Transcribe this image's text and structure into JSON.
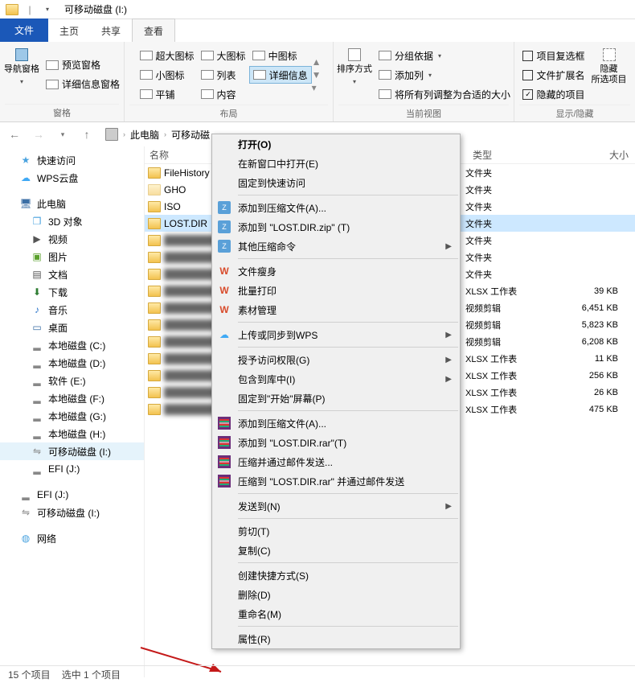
{
  "titlebar": {
    "title": "可移动磁盘 (I:)"
  },
  "tabs": {
    "file": "文件",
    "home": "主页",
    "share": "共享",
    "view": "查看"
  },
  "ribbon": {
    "pane": {
      "nav": "导航窗格",
      "preview": "预览窗格",
      "details": "详细信息窗格",
      "group": "窗格"
    },
    "layout": {
      "xl": "超大图标",
      "lg": "大图标",
      "md": "中图标",
      "sm": "小图标",
      "list": "列表",
      "det": "详细信息",
      "tiles": "平铺",
      "content": "内容",
      "group": "布局"
    },
    "view": {
      "sort": "排序方式",
      "groupby": "分组依据",
      "addcol": "添加列",
      "fitcols": "将所有列调整为合适的大小",
      "group": "当前视图"
    },
    "showhide": {
      "itemchk": "项目复选框",
      "ext": "文件扩展名",
      "hidden": "隐藏的项目",
      "hidebtn": "隐藏\n所选项目",
      "group": "显示/隐藏"
    }
  },
  "breadcrumb": {
    "pc": "此电脑",
    "drive": "可移动磁"
  },
  "tree": [
    {
      "label": "快速访问",
      "icon": "star",
      "color": "#4aa3df"
    },
    {
      "label": "WPS云盘",
      "icon": "cloud",
      "color": "#3fa9f5"
    },
    {
      "label": "此电脑",
      "icon": "monitor",
      "color": "#3b6ea5"
    },
    {
      "label": "3D 对象",
      "icon": "cube",
      "color": "#4aa3df",
      "indent": true
    },
    {
      "label": "视频",
      "icon": "video",
      "color": "#555",
      "indent": true
    },
    {
      "label": "图片",
      "icon": "image",
      "color": "#5aa02c",
      "indent": true
    },
    {
      "label": "文档",
      "icon": "doc",
      "color": "#555",
      "indent": true
    },
    {
      "label": "下载",
      "icon": "down",
      "color": "#2e7d32",
      "indent": true
    },
    {
      "label": "音乐",
      "icon": "music",
      "color": "#2a74c9",
      "indent": true
    },
    {
      "label": "桌面",
      "icon": "desktop",
      "color": "#3b6ea5",
      "indent": true
    },
    {
      "label": "本地磁盘 (C:)",
      "icon": "drive",
      "color": "#888",
      "indent": true
    },
    {
      "label": "本地磁盘 (D:)",
      "icon": "drive",
      "color": "#888",
      "indent": true
    },
    {
      "label": "软件 (E:)",
      "icon": "drive",
      "color": "#888",
      "indent": true
    },
    {
      "label": "本地磁盘 (F:)",
      "icon": "drive",
      "color": "#888",
      "indent": true
    },
    {
      "label": "本地磁盘 (G:)",
      "icon": "drive",
      "color": "#888",
      "indent": true
    },
    {
      "label": "本地磁盘 (H:)",
      "icon": "drive",
      "color": "#888",
      "indent": true
    },
    {
      "label": "可移动磁盘 (I:)",
      "icon": "usb",
      "color": "#888",
      "indent": true,
      "sel": true
    },
    {
      "label": "EFI (J:)",
      "icon": "drive",
      "color": "#888",
      "indent": true
    },
    {
      "label": "EFI (J:)",
      "icon": "drive",
      "color": "#888"
    },
    {
      "label": "可移动磁盘 (I:)",
      "icon": "usb",
      "color": "#888"
    },
    {
      "label": "网络",
      "icon": "net",
      "color": "#4aa3df"
    }
  ],
  "columns": {
    "name": "名称",
    "type": "类型",
    "size": "大小"
  },
  "rows": [
    {
      "name": "FileHistory",
      "type": "文件夹",
      "size": ""
    },
    {
      "name": "GHO",
      "type": "文件夹",
      "size": "",
      "ghost": true
    },
    {
      "name": "ISO",
      "type": "文件夹",
      "size": ""
    },
    {
      "name": "LOST.DIR",
      "type": "文件夹",
      "size": "",
      "sel": true
    },
    {
      "name": "",
      "type": "文件夹",
      "size": "",
      "blur": true
    },
    {
      "name": "",
      "type": "文件夹",
      "size": "",
      "blur": true
    },
    {
      "name": "",
      "type": "文件夹",
      "size": "",
      "blur": true
    },
    {
      "name": "",
      "type": "XLSX 工作表",
      "size": "39 KB",
      "blur": true
    },
    {
      "name": "",
      "type": "视频剪辑",
      "size": "6,451 KB",
      "blur": true
    },
    {
      "name": "",
      "type": "视频剪辑",
      "size": "5,823 KB",
      "blur": true
    },
    {
      "name": "",
      "type": "视频剪辑",
      "size": "6,208 KB",
      "blur": true
    },
    {
      "name": "",
      "type": "XLSX 工作表",
      "size": "11 KB",
      "blur": true
    },
    {
      "name": "",
      "type": "XLSX 工作表",
      "size": "256 KB",
      "blur": true
    },
    {
      "name": "",
      "type": "XLSX 工作表",
      "size": "26 KB",
      "blur": true
    },
    {
      "name": "",
      "type": "XLSX 工作表",
      "size": "475 KB",
      "blur": true
    }
  ],
  "ctx": [
    {
      "k": "open",
      "label": "打开(O)",
      "default": true
    },
    {
      "k": "newwin",
      "label": "在新窗口中打开(E)"
    },
    {
      "k": "pinqa",
      "label": "固定到快速访问"
    },
    {
      "sep": true
    },
    {
      "k": "addarc",
      "label": "添加到压缩文件(A)...",
      "icon": "zip"
    },
    {
      "k": "addzip",
      "label": "添加到 \"LOST.DIR.zip\" (T)",
      "icon": "zip"
    },
    {
      "k": "otherzip",
      "label": "其他压缩命令",
      "icon": "zip",
      "sub": true
    },
    {
      "sep": true
    },
    {
      "k": "wps1",
      "label": "文件瘦身",
      "icon": "wps"
    },
    {
      "k": "wps2",
      "label": "批量打印",
      "icon": "wps"
    },
    {
      "k": "wps3",
      "label": "素材管理",
      "icon": "wps"
    },
    {
      "sep": true
    },
    {
      "k": "upwps",
      "label": "上传或同步到WPS",
      "icon": "cloud",
      "sub": true
    },
    {
      "sep": true
    },
    {
      "k": "grant",
      "label": "授予访问权限(G)",
      "sub": true
    },
    {
      "k": "library",
      "label": "包含到库中(I)",
      "sub": true
    },
    {
      "k": "pinstart",
      "label": "固定到\"开始\"屏幕(P)"
    },
    {
      "sep": true
    },
    {
      "k": "rar1",
      "label": "添加到压缩文件(A)...",
      "icon": "rar"
    },
    {
      "k": "rar2",
      "label": "添加到 \"LOST.DIR.rar\"(T)",
      "icon": "rar"
    },
    {
      "k": "rar3",
      "label": "压缩并通过邮件发送...",
      "icon": "rar"
    },
    {
      "k": "rar4",
      "label": "压缩到 \"LOST.DIR.rar\" 并通过邮件发送",
      "icon": "rar"
    },
    {
      "sep": true
    },
    {
      "k": "sendto",
      "label": "发送到(N)",
      "sub": true
    },
    {
      "sep": true
    },
    {
      "k": "cut",
      "label": "剪切(T)"
    },
    {
      "k": "copy",
      "label": "复制(C)"
    },
    {
      "sep": true
    },
    {
      "k": "shortcut",
      "label": "创建快捷方式(S)"
    },
    {
      "k": "delete",
      "label": "删除(D)"
    },
    {
      "k": "rename",
      "label": "重命名(M)"
    },
    {
      "sep": true
    },
    {
      "k": "props",
      "label": "属性(R)"
    }
  ],
  "status": {
    "items": "15 个项目",
    "sel": "选中 1 个项目"
  }
}
